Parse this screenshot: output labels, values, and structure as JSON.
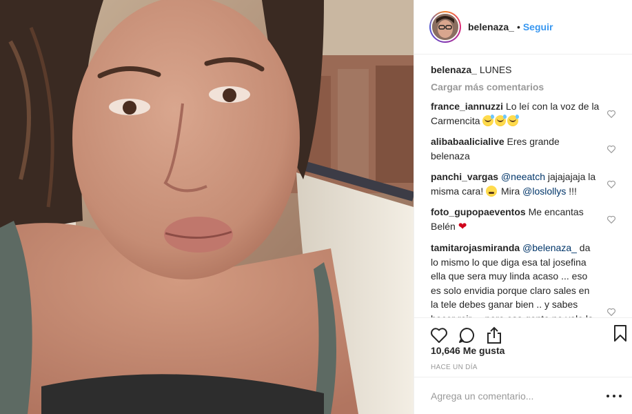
{
  "header": {
    "username": "belenaza_",
    "separator": "•",
    "follow_label": "Seguir"
  },
  "caption": {
    "username": "belenaza_",
    "text": "LUNES"
  },
  "load_more_label": "Cargar más comentarios",
  "comments": [
    {
      "username": "france_iannuzzi",
      "text": "Lo leí con la voz de la Carmencita",
      "emojis": [
        "sweat-smile-emoji",
        "sweat-smile-emoji",
        "sweat-smile-emoji"
      ]
    },
    {
      "username": "alibabaalicialive",
      "text": "Eres grande belenaza"
    },
    {
      "username": "panchi_vargas",
      "mention1": "@neeatch",
      "text1": " jajajajaja la misma cara! ",
      "text2": " Mira ",
      "mention2": "@loslollys",
      "text3": " !!!",
      "emoji": "kissing-face-emoji"
    },
    {
      "username": "foto_gupopaeventos",
      "text": "Me encantas Belén",
      "emoji": "red-heart-emoji"
    },
    {
      "username": "tamitarojasmiranda",
      "mention": "@belenaza_",
      "text": " da lo mismo lo que diga esa tal josefina ella que sera muy linda acaso ... eso es solo envidia porque claro sales en la tele debes ganar bien .. y sabes hacer reir ... pero esa gente no vale la pena no hay mas patetica que seguir a alguien para solo escribirle eso que pincanteria ... es ella no tuu .. cariños no pesques gente"
    }
  ],
  "likes": "10,646 Me gusta",
  "timestamp": "Hace un día",
  "add_comment": {
    "placeholder": "Agrega un comentario..."
  },
  "colors": {
    "link": "#3897f0",
    "mention": "#003569",
    "muted": "#999999",
    "text": "#262626"
  },
  "icons": [
    "heart-icon",
    "comment-icon",
    "share-icon",
    "bookmark-icon",
    "more-options-icon"
  ]
}
